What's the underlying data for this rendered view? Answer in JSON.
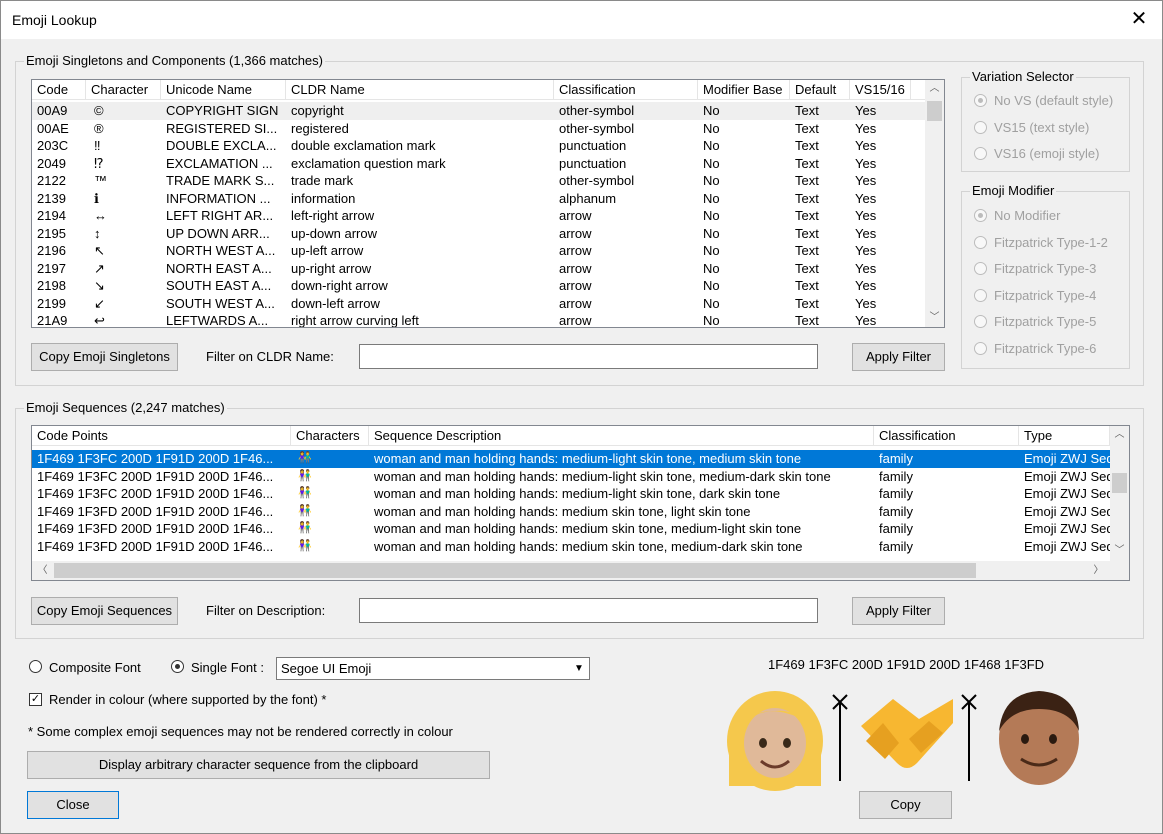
{
  "window": {
    "title": "Emoji Lookup",
    "close_glyph": "✕"
  },
  "singletons": {
    "group_label": "Emoji Singletons and Components (1,366 matches)",
    "columns": [
      "Code",
      "Character",
      "Unicode Name",
      "CLDR Name",
      "Classification",
      "Modifier Base",
      "Default",
      "VS15/16"
    ],
    "rows": [
      {
        "code": "00A9",
        "char": "©",
        "uname": "COPYRIGHT SIGN",
        "cldr": "copyright",
        "cls": "other-symbol",
        "mod": "No",
        "def": "Text",
        "vs": "Yes"
      },
      {
        "code": "00AE",
        "char": "®",
        "uname": "REGISTERED SI...",
        "cldr": "registered",
        "cls": "other-symbol",
        "mod": "No",
        "def": "Text",
        "vs": "Yes"
      },
      {
        "code": "203C",
        "char": "‼",
        "uname": "DOUBLE EXCLA...",
        "cldr": "double exclamation mark",
        "cls": "punctuation",
        "mod": "No",
        "def": "Text",
        "vs": "Yes"
      },
      {
        "code": "2049",
        "char": "⁉",
        "uname": "EXCLAMATION ...",
        "cldr": "exclamation question mark",
        "cls": "punctuation",
        "mod": "No",
        "def": "Text",
        "vs": "Yes"
      },
      {
        "code": "2122",
        "char": "™",
        "uname": "TRADE MARK S...",
        "cldr": "trade mark",
        "cls": "other-symbol",
        "mod": "No",
        "def": "Text",
        "vs": "Yes"
      },
      {
        "code": "2139",
        "char": "ℹ",
        "uname": "INFORMATION ...",
        "cldr": "information",
        "cls": "alphanum",
        "mod": "No",
        "def": "Text",
        "vs": "Yes"
      },
      {
        "code": "2194",
        "char": "↔",
        "uname": "LEFT RIGHT AR...",
        "cldr": "left-right arrow",
        "cls": "arrow",
        "mod": "No",
        "def": "Text",
        "vs": "Yes"
      },
      {
        "code": "2195",
        "char": "↕",
        "uname": "UP DOWN ARR...",
        "cldr": "up-down arrow",
        "cls": "arrow",
        "mod": "No",
        "def": "Text",
        "vs": "Yes"
      },
      {
        "code": "2196",
        "char": "↖",
        "uname": "NORTH WEST A...",
        "cldr": "up-left arrow",
        "cls": "arrow",
        "mod": "No",
        "def": "Text",
        "vs": "Yes"
      },
      {
        "code": "2197",
        "char": "↗",
        "uname": "NORTH EAST A...",
        "cldr": "up-right arrow",
        "cls": "arrow",
        "mod": "No",
        "def": "Text",
        "vs": "Yes"
      },
      {
        "code": "2198",
        "char": "↘",
        "uname": "SOUTH EAST A...",
        "cldr": "down-right arrow",
        "cls": "arrow",
        "mod": "No",
        "def": "Text",
        "vs": "Yes"
      },
      {
        "code": "2199",
        "char": "↙",
        "uname": "SOUTH WEST A...",
        "cldr": "down-left arrow",
        "cls": "arrow",
        "mod": "No",
        "def": "Text",
        "vs": "Yes"
      },
      {
        "code": "21A9",
        "char": "↩",
        "uname": "LEFTWARDS A...",
        "cldr": "right arrow curving left",
        "cls": "arrow",
        "mod": "No",
        "def": "Text",
        "vs": "Yes"
      }
    ],
    "copy_button": "Copy Emoji Singletons",
    "filter_label": "Filter on CLDR Name:",
    "filter_value": "",
    "apply_button": "Apply Filter"
  },
  "variation_selector": {
    "group_label": "Variation Selector",
    "options": [
      "No VS (default style)",
      "VS15 (text style)",
      "VS16 (emoji style)"
    ],
    "selected": 0
  },
  "emoji_modifier": {
    "group_label": "Emoji Modifier",
    "options": [
      "No Modifier",
      "Fitzpatrick Type-1-2",
      "Fitzpatrick Type-3",
      "Fitzpatrick Type-4",
      "Fitzpatrick Type-5",
      "Fitzpatrick Type-6"
    ],
    "selected": 0
  },
  "sequences": {
    "group_label": "Emoji Sequences (2,247 matches)",
    "columns": [
      "Code Points",
      "Characters",
      "Sequence Description",
      "Classification",
      "Type"
    ],
    "rows": [
      {
        "cp": "1F469 1F3FC 200D 1F91D 200D 1F46...",
        "ch": "👫",
        "desc": "woman and man holding hands: medium-light skin tone, medium skin tone",
        "cls": "family",
        "type": "Emoji ZWJ Seq"
      },
      {
        "cp": "1F469 1F3FC 200D 1F91D 200D 1F46...",
        "ch": "👫",
        "desc": "woman and man holding hands: medium-light skin tone, medium-dark skin tone",
        "cls": "family",
        "type": "Emoji ZWJ Seq"
      },
      {
        "cp": "1F469 1F3FC 200D 1F91D 200D 1F46...",
        "ch": "👫",
        "desc": "woman and man holding hands: medium-light skin tone, dark skin tone",
        "cls": "family",
        "type": "Emoji ZWJ Seq"
      },
      {
        "cp": "1F469 1F3FD 200D 1F91D 200D 1F46...",
        "ch": "👫",
        "desc": "woman and man holding hands: medium skin tone, light skin tone",
        "cls": "family",
        "type": "Emoji ZWJ Seq"
      },
      {
        "cp": "1F469 1F3FD 200D 1F91D 200D 1F46...",
        "ch": "👫",
        "desc": "woman and man holding hands: medium skin tone, medium-light skin tone",
        "cls": "family",
        "type": "Emoji ZWJ Seq"
      },
      {
        "cp": "1F469 1F3FD 200D 1F91D 200D 1F46...",
        "ch": "👫",
        "desc": "woman and man holding hands: medium skin tone, medium-dark skin tone",
        "cls": "family",
        "type": "Emoji ZWJ Seq"
      }
    ],
    "selected_row": 0,
    "copy_button": "Copy Emoji Sequences",
    "filter_label": "Filter on Description:",
    "filter_value": "",
    "apply_button": "Apply Filter"
  },
  "font": {
    "composite_label": "Composite Font",
    "single_label": "Single Font :",
    "selected": "single",
    "font_name": "Segoe UI Emoji",
    "render_colour_label": "Render in colour (where supported by the font) *",
    "render_colour_checked": true,
    "note": "* Some complex emoji sequences may not be rendered correctly in colour",
    "display_button": "Display arbitrary character sequence from the clipboard"
  },
  "preview": {
    "code_points": "1F469 1F3FC 200D 1F91D 200D 1F468 1F3FD",
    "copy_button": "Copy"
  },
  "close_button": "Close",
  "colors": {
    "selection": "#0078d7",
    "hair": "#f5c84c",
    "skin_light": "#e0b999",
    "skin_medium": "#b47a57",
    "handshake": "#f7b731"
  }
}
